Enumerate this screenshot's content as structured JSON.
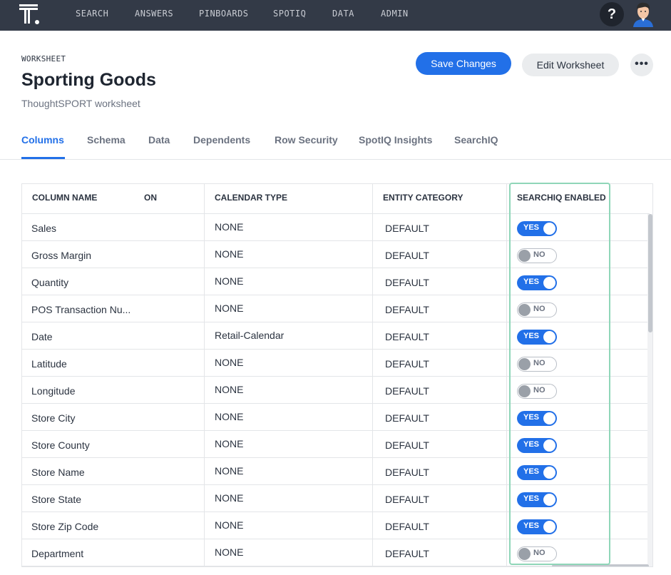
{
  "nav": {
    "logo_icon": "thoughtspot-logo-icon",
    "items": [
      "SEARCH",
      "ANSWERS",
      "PINBOARDS",
      "SPOTIQ",
      "DATA",
      "ADMIN"
    ],
    "help_label": "?",
    "avatar_icon": "user-avatar-icon"
  },
  "header": {
    "eyebrow": "WORKSHEET",
    "title": "Sporting Goods",
    "subtitle": "ThoughtSPORT worksheet",
    "save_label": "Save Changes",
    "edit_label": "Edit Worksheet",
    "more_icon": "more-dots-icon",
    "more_label": "•••"
  },
  "tabs": [
    "Columns",
    "Schema",
    "Data",
    "Dependents",
    "Row Security",
    "SpotIQ Insights",
    "SearchIQ"
  ],
  "active_tab": "Columns",
  "table": {
    "headers": [
      "COLUMN NAME",
      "ON",
      "CALENDAR TYPE",
      "ENTITY CATEGORY",
      "SEARCHIQ ENABLED"
    ],
    "rows": [
      {
        "name": "Sales",
        "calendar": "NONE",
        "entity": "DEFAULT",
        "enabled": true
      },
      {
        "name": "Gross Margin",
        "calendar": "NONE",
        "entity": "DEFAULT",
        "enabled": false
      },
      {
        "name": "Quantity",
        "calendar": "NONE",
        "entity": "DEFAULT",
        "enabled": true
      },
      {
        "name": "POS Transaction Nu...",
        "calendar": "NONE",
        "entity": "DEFAULT",
        "enabled": false
      },
      {
        "name": "Date",
        "calendar": "Retail-Calendar",
        "entity": "DEFAULT",
        "enabled": true
      },
      {
        "name": "Latitude",
        "calendar": "NONE",
        "entity": "DEFAULT",
        "enabled": false
      },
      {
        "name": "Longitude",
        "calendar": "NONE",
        "entity": "DEFAULT",
        "enabled": false
      },
      {
        "name": "Store City",
        "calendar": "NONE",
        "entity": "DEFAULT",
        "enabled": true
      },
      {
        "name": "Store County",
        "calendar": "NONE",
        "entity": "DEFAULT",
        "enabled": true
      },
      {
        "name": "Store Name",
        "calendar": "NONE",
        "entity": "DEFAULT",
        "enabled": true
      },
      {
        "name": "Store State",
        "calendar": "NONE",
        "entity": "DEFAULT",
        "enabled": true
      },
      {
        "name": "Store Zip Code",
        "calendar": "NONE",
        "entity": "DEFAULT",
        "enabled": true
      },
      {
        "name": "Department",
        "calendar": "NONE",
        "entity": "DEFAULT",
        "enabled": false
      }
    ],
    "yes_label": "YES",
    "no_label": "NO"
  },
  "colors": {
    "nav_bg": "#333a47",
    "accent": "#2270e8",
    "highlight": "#8fd6b8"
  }
}
